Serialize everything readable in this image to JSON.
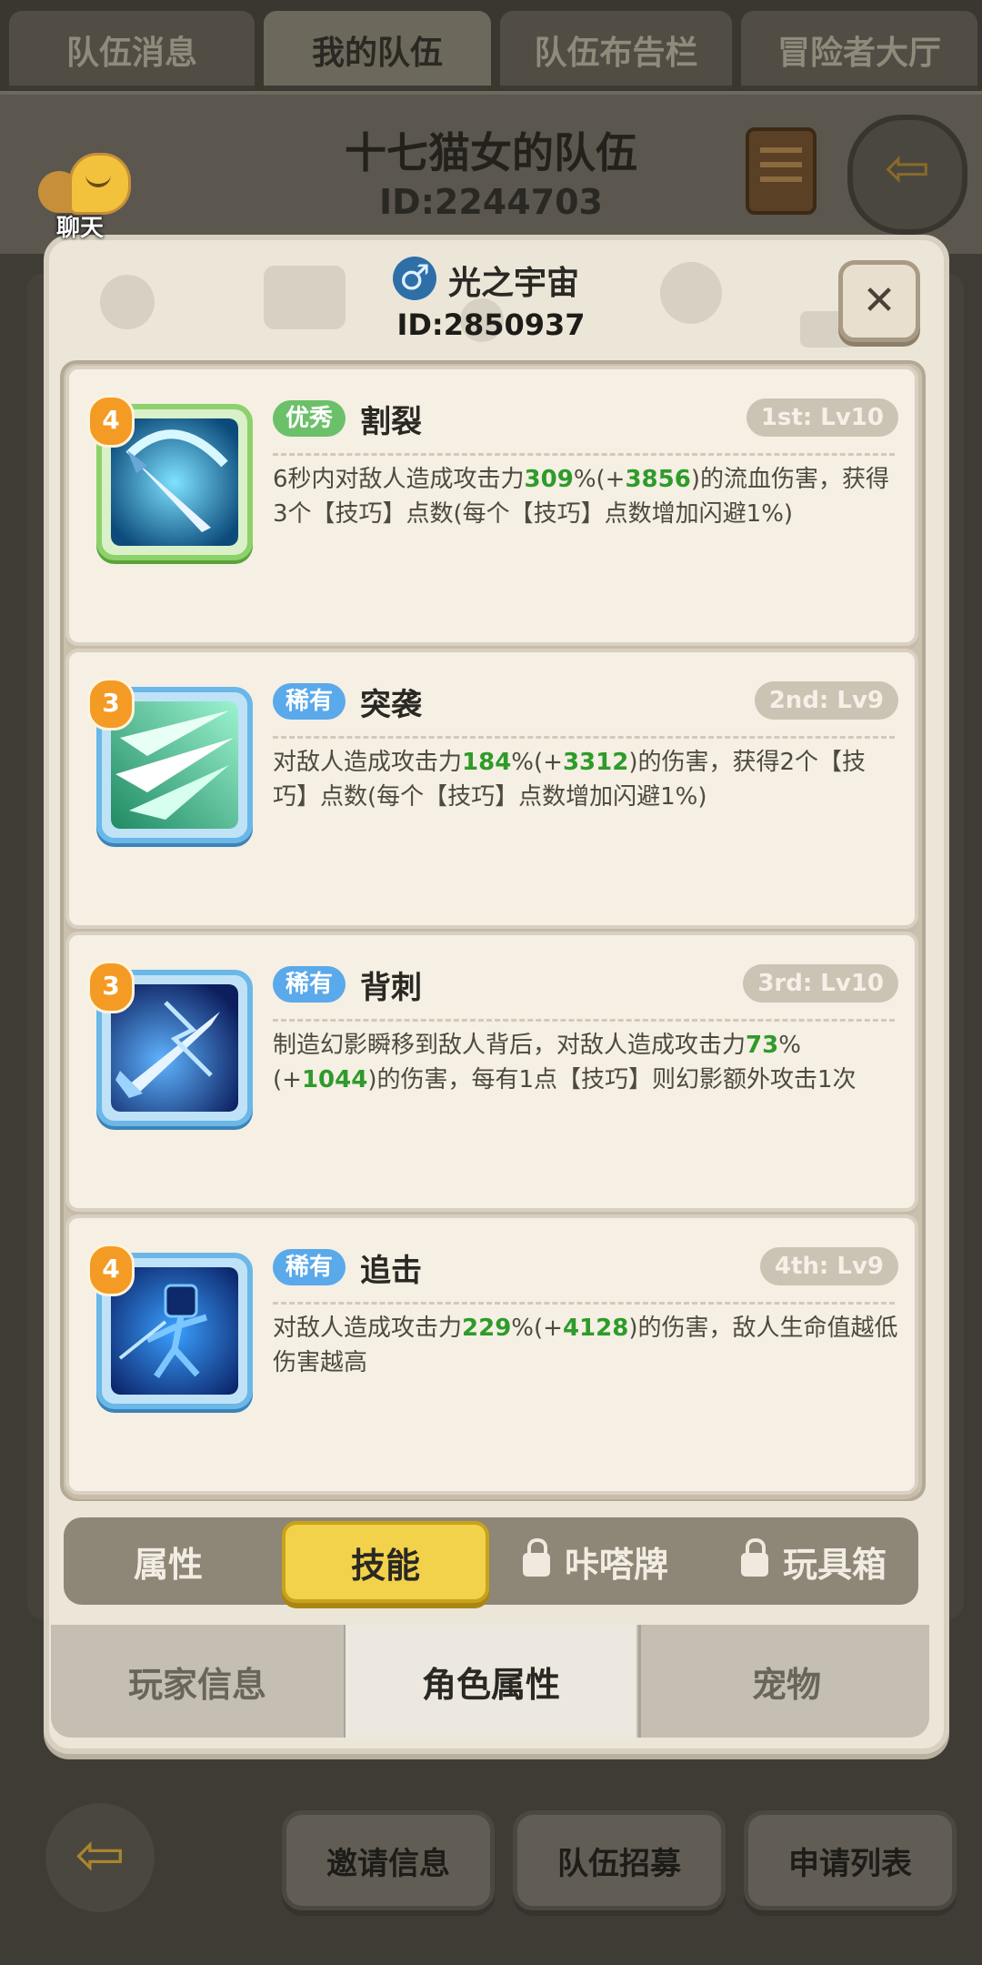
{
  "top_tabs": [
    "队伍消息",
    "我的队伍",
    "队伍布告栏",
    "冒险者大厅"
  ],
  "team": {
    "name": "十七猫女的队伍",
    "id": "ID:2244703"
  },
  "chat": {
    "label": "聊天"
  },
  "player": {
    "name": "光之宇宙",
    "id": "ID:2850937",
    "gender_icon": "male-icon"
  },
  "skills": [
    {
      "level": "4",
      "rarity": "优秀",
      "rarity_color": "#6cc06a",
      "name": "割裂",
      "slot": "1st: Lv10",
      "desc_parts": [
        "6秒内对敌人造成攻击力",
        "309",
        "%(+",
        "3856",
        ")的流血伤害，获得3个【技巧】点数(每个【技巧】点数增加闪避1%)"
      ]
    },
    {
      "level": "3",
      "rarity": "稀有",
      "rarity_color": "#5aa9ea",
      "name": "突袭",
      "slot": "2nd: Lv9",
      "desc_parts": [
        "对敌人造成攻击力",
        "184",
        "%(+",
        "3312",
        ")的伤害，获得2个【技巧】点数(每个【技巧】点数增加闪避1%)"
      ]
    },
    {
      "level": "3",
      "rarity": "稀有",
      "rarity_color": "#5aa9ea",
      "name": "背刺",
      "slot": "3rd: Lv10",
      "desc_parts": [
        "制造幻影瞬移到敌人背后，对敌人造成攻击力",
        "73",
        "%(+",
        "1044",
        ")的伤害，每有1点【技巧】则幻影额外攻击1次"
      ]
    },
    {
      "level": "4",
      "rarity": "稀有",
      "rarity_color": "#5aa9ea",
      "name": "追击",
      "slot": "4th: Lv9",
      "desc_parts": [
        "对敌人造成攻击力",
        "229",
        "%(+",
        "4128",
        ")的伤害，敌人生命值越低伤害越高"
      ]
    }
  ],
  "sub_tabs": [
    "属性",
    "技能",
    "咔嗒牌",
    "玩具箱"
  ],
  "bottom_tabs": [
    "玩家信息",
    "角色属性",
    "宠物"
  ],
  "footer": {
    "buttons": [
      "邀请信息",
      "队伍招募",
      "申请列表"
    ]
  }
}
